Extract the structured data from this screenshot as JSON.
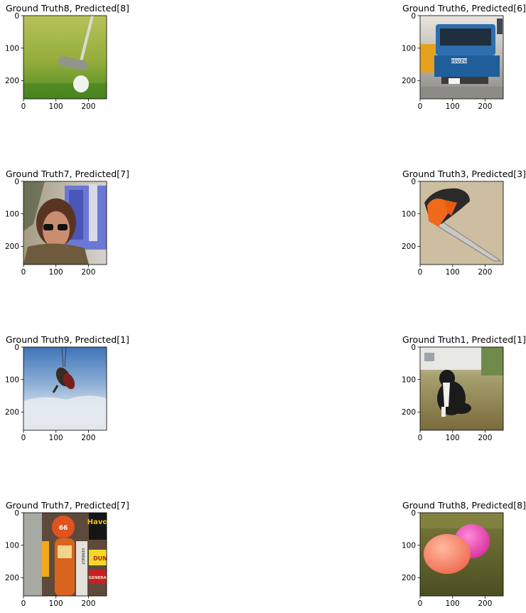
{
  "chart_data": [
    {
      "type": "image",
      "title": "Ground Truth8, Predicted[8]",
      "image_content": "golf-putter-and-ball",
      "xlim": [
        0,
        256
      ],
      "ylim": [
        256,
        0
      ],
      "xticks": [
        "0",
        "100",
        "200"
      ],
      "yticks": [
        "0",
        "100",
        "200"
      ]
    },
    {
      "type": "image",
      "title": "Ground Truth6, Predicted[6]",
      "image_content": "blue-isuzu-truck",
      "xlim": [
        0,
        256
      ],
      "ylim": [
        256,
        0
      ],
      "xticks": [
        "0",
        "100",
        "200"
      ],
      "yticks": [
        "0",
        "100",
        "200"
      ]
    },
    {
      "type": "image",
      "title": "Ground Truth7, Predicted[7]",
      "image_content": "woman-in-car-at-gas-station",
      "xlim": [
        0,
        256
      ],
      "ylim": [
        256,
        0
      ],
      "xticks": [
        "0",
        "100",
        "200"
      ],
      "yticks": [
        "0",
        "100",
        "200"
      ]
    },
    {
      "type": "image",
      "title": "Ground Truth3, Predicted[3]",
      "image_content": "orange-chainsaw",
      "xlim": [
        0,
        256
      ],
      "ylim": [
        256,
        0
      ],
      "xticks": [
        "0",
        "100",
        "200"
      ],
      "yticks": [
        "0",
        "100",
        "200"
      ]
    },
    {
      "type": "image",
      "title": "Ground Truth9, Predicted[1]",
      "image_content": "parachutist-above-clouds",
      "xlim": [
        0,
        256
      ],
      "ylim": [
        256,
        0
      ],
      "xticks": [
        "0",
        "100",
        "200"
      ],
      "yticks": [
        "0",
        "100",
        "200"
      ]
    },
    {
      "type": "image",
      "title": "Ground Truth1, Predicted[1]",
      "image_content": "spaniel-dog-on-grass",
      "xlim": [
        0,
        256
      ],
      "ylim": [
        256,
        0
      ],
      "xticks": [
        "0",
        "100",
        "200"
      ],
      "yticks": [
        "0",
        "100",
        "200"
      ]
    },
    {
      "type": "image",
      "title": "Ground Truth7, Predicted[7]",
      "image_content": "vintage-gas-pump-with-signs",
      "xlim": [
        0,
        256
      ],
      "ylim": [
        256,
        0
      ],
      "xticks": [
        "0",
        "100",
        "200"
      ],
      "yticks": [
        "0",
        "100",
        "200"
      ]
    },
    {
      "type": "image",
      "title": "Ground Truth8, Predicted[8]",
      "image_content": "pink-golf-balls-on-grass",
      "xlim": [
        0,
        256
      ],
      "ylim": [
        256,
        0
      ],
      "xticks": [
        "0",
        "100",
        "200"
      ],
      "yticks": [
        "0",
        "100",
        "200"
      ]
    }
  ],
  "sign_text": {
    "truck_badge": "ISUZU",
    "pump_badge": "66",
    "sign_havoline": "Havo",
    "sign_dun": "DUN",
    "sign_general": "GENERAL",
    "sign_remington": "REMINGT"
  }
}
